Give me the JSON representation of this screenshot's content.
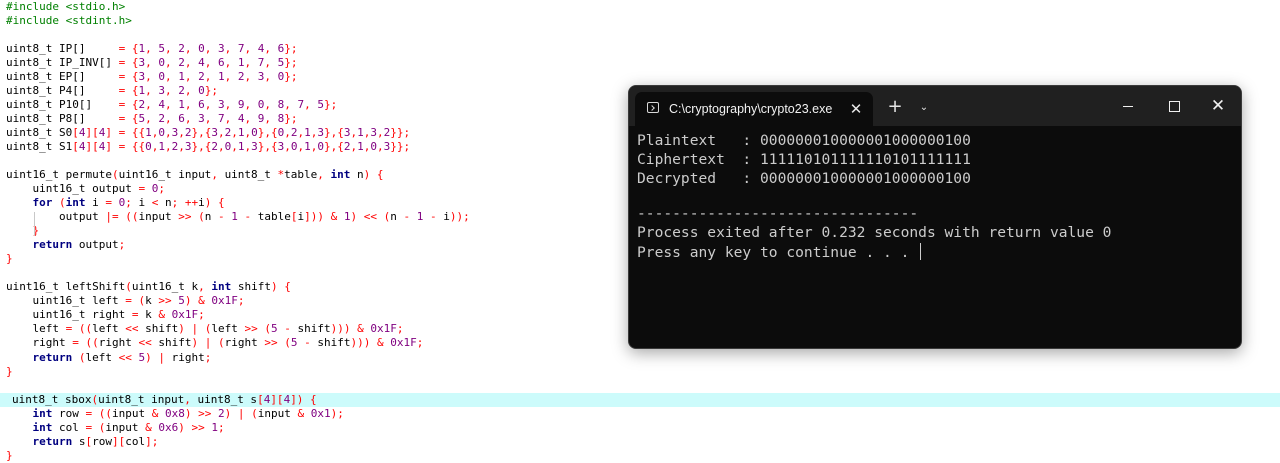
{
  "editor": {
    "lines": [
      [
        [
          "pp",
          "#include <stdio.h>"
        ]
      ],
      [
        [
          "pp",
          "#include <stdint.h>"
        ]
      ],
      [],
      [
        [
          "id",
          "uint8_t IP[]     "
        ],
        [
          "op",
          "= {"
        ],
        [
          "num",
          "1"
        ],
        [
          "op",
          ", "
        ],
        [
          "num",
          "5"
        ],
        [
          "op",
          ", "
        ],
        [
          "num",
          "2"
        ],
        [
          "op",
          ", "
        ],
        [
          "num",
          "0"
        ],
        [
          "op",
          ", "
        ],
        [
          "num",
          "3"
        ],
        [
          "op",
          ", "
        ],
        [
          "num",
          "7"
        ],
        [
          "op",
          ", "
        ],
        [
          "num",
          "4"
        ],
        [
          "op",
          ", "
        ],
        [
          "num",
          "6"
        ],
        [
          "op",
          "};"
        ]
      ],
      [
        [
          "id",
          "uint8_t IP_INV[] "
        ],
        [
          "op",
          "= {"
        ],
        [
          "num",
          "3"
        ],
        [
          "op",
          ", "
        ],
        [
          "num",
          "0"
        ],
        [
          "op",
          ", "
        ],
        [
          "num",
          "2"
        ],
        [
          "op",
          ", "
        ],
        [
          "num",
          "4"
        ],
        [
          "op",
          ", "
        ],
        [
          "num",
          "6"
        ],
        [
          "op",
          ", "
        ],
        [
          "num",
          "1"
        ],
        [
          "op",
          ", "
        ],
        [
          "num",
          "7"
        ],
        [
          "op",
          ", "
        ],
        [
          "num",
          "5"
        ],
        [
          "op",
          "};"
        ]
      ],
      [
        [
          "id",
          "uint8_t EP[]     "
        ],
        [
          "op",
          "= {"
        ],
        [
          "num",
          "3"
        ],
        [
          "op",
          ", "
        ],
        [
          "num",
          "0"
        ],
        [
          "op",
          ", "
        ],
        [
          "num",
          "1"
        ],
        [
          "op",
          ", "
        ],
        [
          "num",
          "2"
        ],
        [
          "op",
          ", "
        ],
        [
          "num",
          "1"
        ],
        [
          "op",
          ", "
        ],
        [
          "num",
          "2"
        ],
        [
          "op",
          ", "
        ],
        [
          "num",
          "3"
        ],
        [
          "op",
          ", "
        ],
        [
          "num",
          "0"
        ],
        [
          "op",
          "};"
        ]
      ],
      [
        [
          "id",
          "uint8_t P4[]     "
        ],
        [
          "op",
          "= {"
        ],
        [
          "num",
          "1"
        ],
        [
          "op",
          ", "
        ],
        [
          "num",
          "3"
        ],
        [
          "op",
          ", "
        ],
        [
          "num",
          "2"
        ],
        [
          "op",
          ", "
        ],
        [
          "num",
          "0"
        ],
        [
          "op",
          "};"
        ]
      ],
      [
        [
          "id",
          "uint8_t P10[]    "
        ],
        [
          "op",
          "= {"
        ],
        [
          "num",
          "2"
        ],
        [
          "op",
          ", "
        ],
        [
          "num",
          "4"
        ],
        [
          "op",
          ", "
        ],
        [
          "num",
          "1"
        ],
        [
          "op",
          ", "
        ],
        [
          "num",
          "6"
        ],
        [
          "op",
          ", "
        ],
        [
          "num",
          "3"
        ],
        [
          "op",
          ", "
        ],
        [
          "num",
          "9"
        ],
        [
          "op",
          ", "
        ],
        [
          "num",
          "0"
        ],
        [
          "op",
          ", "
        ],
        [
          "num",
          "8"
        ],
        [
          "op",
          ", "
        ],
        [
          "num",
          "7"
        ],
        [
          "op",
          ", "
        ],
        [
          "num",
          "5"
        ],
        [
          "op",
          "};"
        ]
      ],
      [
        [
          "id",
          "uint8_t P8[]     "
        ],
        [
          "op",
          "= {"
        ],
        [
          "num",
          "5"
        ],
        [
          "op",
          ", "
        ],
        [
          "num",
          "2"
        ],
        [
          "op",
          ", "
        ],
        [
          "num",
          "6"
        ],
        [
          "op",
          ", "
        ],
        [
          "num",
          "3"
        ],
        [
          "op",
          ", "
        ],
        [
          "num",
          "7"
        ],
        [
          "op",
          ", "
        ],
        [
          "num",
          "4"
        ],
        [
          "op",
          ", "
        ],
        [
          "num",
          "9"
        ],
        [
          "op",
          ", "
        ],
        [
          "num",
          "8"
        ],
        [
          "op",
          "};"
        ]
      ],
      [
        [
          "id",
          "uint8_t S0"
        ],
        [
          "op",
          "["
        ],
        [
          "num",
          "4"
        ],
        [
          "op",
          "]["
        ],
        [
          "num",
          "4"
        ],
        [
          "op",
          "] = {{"
        ],
        [
          "num",
          "1"
        ],
        [
          "op",
          ","
        ],
        [
          "num",
          "0"
        ],
        [
          "op",
          ","
        ],
        [
          "num",
          "3"
        ],
        [
          "op",
          ","
        ],
        [
          "num",
          "2"
        ],
        [
          "op",
          "},{"
        ],
        [
          "num",
          "3"
        ],
        [
          "op",
          ","
        ],
        [
          "num",
          "2"
        ],
        [
          "op",
          ","
        ],
        [
          "num",
          "1"
        ],
        [
          "op",
          ","
        ],
        [
          "num",
          "0"
        ],
        [
          "op",
          "},{"
        ],
        [
          "num",
          "0"
        ],
        [
          "op",
          ","
        ],
        [
          "num",
          "2"
        ],
        [
          "op",
          ","
        ],
        [
          "num",
          "1"
        ],
        [
          "op",
          ","
        ],
        [
          "num",
          "3"
        ],
        [
          "op",
          "},{"
        ],
        [
          "num",
          "3"
        ],
        [
          "op",
          ","
        ],
        [
          "num",
          "1"
        ],
        [
          "op",
          ","
        ],
        [
          "num",
          "3"
        ],
        [
          "op",
          ","
        ],
        [
          "num",
          "2"
        ],
        [
          "op",
          "}};"
        ]
      ],
      [
        [
          "id",
          "uint8_t S1"
        ],
        [
          "op",
          "["
        ],
        [
          "num",
          "4"
        ],
        [
          "op",
          "]["
        ],
        [
          "num",
          "4"
        ],
        [
          "op",
          "] = {{"
        ],
        [
          "num",
          "0"
        ],
        [
          "op",
          ","
        ],
        [
          "num",
          "1"
        ],
        [
          "op",
          ","
        ],
        [
          "num",
          "2"
        ],
        [
          "op",
          ","
        ],
        [
          "num",
          "3"
        ],
        [
          "op",
          "},{"
        ],
        [
          "num",
          "2"
        ],
        [
          "op",
          ","
        ],
        [
          "num",
          "0"
        ],
        [
          "op",
          ","
        ],
        [
          "num",
          "1"
        ],
        [
          "op",
          ","
        ],
        [
          "num",
          "3"
        ],
        [
          "op",
          "},{"
        ],
        [
          "num",
          "3"
        ],
        [
          "op",
          ","
        ],
        [
          "num",
          "0"
        ],
        [
          "op",
          ","
        ],
        [
          "num",
          "1"
        ],
        [
          "op",
          ","
        ],
        [
          "num",
          "0"
        ],
        [
          "op",
          "},{"
        ],
        [
          "num",
          "2"
        ],
        [
          "op",
          ","
        ],
        [
          "num",
          "1"
        ],
        [
          "op",
          ","
        ],
        [
          "num",
          "0"
        ],
        [
          "op",
          ","
        ],
        [
          "num",
          "3"
        ],
        [
          "op",
          "}};"
        ]
      ],
      [],
      [
        [
          "id",
          "uint16_t permute"
        ],
        [
          "op",
          "("
        ],
        [
          "id",
          "uint16_t input"
        ],
        [
          "op",
          ", "
        ],
        [
          "id",
          "uint8_t "
        ],
        [
          "op",
          "*"
        ],
        [
          "id",
          "table"
        ],
        [
          "op",
          ", "
        ],
        [
          "kw",
          "int"
        ],
        [
          "id",
          " n"
        ],
        [
          "op",
          ") {"
        ]
      ],
      [
        [
          "id",
          "    uint16_t output "
        ],
        [
          "op",
          "= "
        ],
        [
          "num",
          "0"
        ],
        [
          "op",
          ";"
        ]
      ],
      [
        [
          "kw",
          "    for "
        ],
        [
          "op",
          "("
        ],
        [
          "kw",
          "int"
        ],
        [
          "id",
          " i "
        ],
        [
          "op",
          "= "
        ],
        [
          "num",
          "0"
        ],
        [
          "op",
          "; "
        ],
        [
          "id",
          "i "
        ],
        [
          "op",
          "< "
        ],
        [
          "id",
          "n"
        ],
        [
          "op",
          "; ++"
        ],
        [
          "id",
          "i"
        ],
        [
          "op",
          ") {"
        ]
      ],
      [
        [
          "id",
          "        output "
        ],
        [
          "op",
          "|= (("
        ],
        [
          "id",
          "input "
        ],
        [
          "op",
          ">> ("
        ],
        [
          "id",
          "n "
        ],
        [
          "op",
          "- "
        ],
        [
          "num",
          "1"
        ],
        [
          "op",
          " - "
        ],
        [
          "id",
          "table"
        ],
        [
          "op",
          "["
        ],
        [
          "id",
          "i"
        ],
        [
          "op",
          "])) & "
        ],
        [
          "num",
          "1"
        ],
        [
          "op",
          ") << ("
        ],
        [
          "id",
          "n "
        ],
        [
          "op",
          "- "
        ],
        [
          "num",
          "1"
        ],
        [
          "op",
          " - "
        ],
        [
          "id",
          "i"
        ],
        [
          "op",
          "));"
        ]
      ],
      [
        [
          "op",
          "    }"
        ]
      ],
      [
        [
          "kw",
          "    return"
        ],
        [
          "id",
          " output"
        ],
        [
          "op",
          ";"
        ]
      ],
      [
        [
          "op",
          "}"
        ]
      ],
      [],
      [
        [
          "id",
          "uint16_t leftShift"
        ],
        [
          "op",
          "("
        ],
        [
          "id",
          "uint16_t k"
        ],
        [
          "op",
          ", "
        ],
        [
          "kw",
          "int"
        ],
        [
          "id",
          " shift"
        ],
        [
          "op",
          ") {"
        ]
      ],
      [
        [
          "id",
          "    uint16_t left "
        ],
        [
          "op",
          "= ("
        ],
        [
          "id",
          "k "
        ],
        [
          "op",
          ">> "
        ],
        [
          "num",
          "5"
        ],
        [
          "op",
          ") & "
        ],
        [
          "num",
          "0x1F"
        ],
        [
          "op",
          ";"
        ]
      ],
      [
        [
          "id",
          "    uint16_t right "
        ],
        [
          "op",
          "= "
        ],
        [
          "id",
          "k "
        ],
        [
          "op",
          "& "
        ],
        [
          "num",
          "0x1F"
        ],
        [
          "op",
          ";"
        ]
      ],
      [
        [
          "id",
          "    left "
        ],
        [
          "op",
          "= (("
        ],
        [
          "id",
          "left "
        ],
        [
          "op",
          "<< "
        ],
        [
          "id",
          "shift"
        ],
        [
          "op",
          ") | ("
        ],
        [
          "id",
          "left "
        ],
        [
          "op",
          ">> ("
        ],
        [
          "num",
          "5"
        ],
        [
          "op",
          " - "
        ],
        [
          "id",
          "shift"
        ],
        [
          "op",
          "))) & "
        ],
        [
          "num",
          "0x1F"
        ],
        [
          "op",
          ";"
        ]
      ],
      [
        [
          "id",
          "    right "
        ],
        [
          "op",
          "= (("
        ],
        [
          "id",
          "right "
        ],
        [
          "op",
          "<< "
        ],
        [
          "id",
          "shift"
        ],
        [
          "op",
          ") | ("
        ],
        [
          "id",
          "right "
        ],
        [
          "op",
          ">> ("
        ],
        [
          "num",
          "5"
        ],
        [
          "op",
          " - "
        ],
        [
          "id",
          "shift"
        ],
        [
          "op",
          "))) & "
        ],
        [
          "num",
          "0x1F"
        ],
        [
          "op",
          ";"
        ]
      ],
      [
        [
          "kw",
          "    return"
        ],
        [
          "op",
          " ("
        ],
        [
          "id",
          "left "
        ],
        [
          "op",
          "<< "
        ],
        [
          "num",
          "5"
        ],
        [
          "op",
          ") | "
        ],
        [
          "id",
          "right"
        ],
        [
          "op",
          ";"
        ]
      ],
      [
        [
          "op",
          "}"
        ]
      ],
      [],
      [
        [
          "id",
          "uint8_t sbox"
        ],
        [
          "op",
          "("
        ],
        [
          "id",
          "uint8_t input"
        ],
        [
          "op",
          ", "
        ],
        [
          "id",
          "uint8_t s"
        ],
        [
          "op",
          "["
        ],
        [
          "num",
          "4"
        ],
        [
          "op",
          "]["
        ],
        [
          "num",
          "4"
        ],
        [
          "op",
          "]) {"
        ]
      ],
      [
        [
          "kw",
          "    int"
        ],
        [
          "id",
          " row "
        ],
        [
          "op",
          "= (("
        ],
        [
          "id",
          "input "
        ],
        [
          "op",
          "& "
        ],
        [
          "num",
          "0x8"
        ],
        [
          "op",
          ") >> "
        ],
        [
          "num",
          "2"
        ],
        [
          "op",
          ") | ("
        ],
        [
          "id",
          "input "
        ],
        [
          "op",
          "& "
        ],
        [
          "num",
          "0x1"
        ],
        [
          "op",
          ");"
        ]
      ],
      [
        [
          "kw",
          "    int"
        ],
        [
          "id",
          " col "
        ],
        [
          "op",
          "= ("
        ],
        [
          "id",
          "input "
        ],
        [
          "op",
          "& "
        ],
        [
          "num",
          "0x6"
        ],
        [
          "op",
          ") >> "
        ],
        [
          "num",
          "1"
        ],
        [
          "op",
          ";"
        ]
      ],
      [
        [
          "kw",
          "    return"
        ],
        [
          "id",
          " s"
        ],
        [
          "op",
          "["
        ],
        [
          "id",
          "row"
        ],
        [
          "op",
          "]["
        ],
        [
          "id",
          "col"
        ],
        [
          "op",
          "];"
        ]
      ],
      [
        [
          "op",
          "}"
        ]
      ]
    ],
    "highlighted_line": 28
  },
  "terminal": {
    "tab_title": "C:\\cryptography\\crypto23.exe",
    "tab_close": "✕",
    "new_tab": "+",
    "dropdown": "⌄",
    "close_glyph": "✕",
    "output_lines": [
      "Plaintext   : 000000010000001000000100",
      "Ciphertext  : 111110101111110101111111",
      "Decrypted   : 000000010000001000000100",
      "",
      "--------------------------------",
      "Process exited after 0.232 seconds with return value 0",
      "Press any key to continue . . . "
    ]
  }
}
